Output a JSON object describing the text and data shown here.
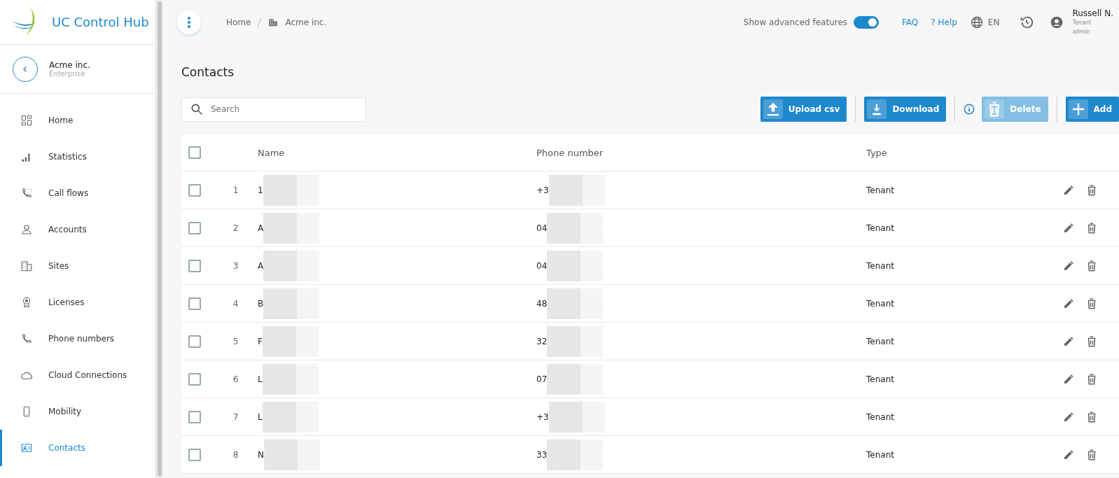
{
  "app": {
    "title": "UC Control Hub"
  },
  "tenant": {
    "name": "Acme inc.",
    "plan": "Enterprise"
  },
  "sidebar": {
    "items": [
      {
        "label": "Home",
        "selected": false
      },
      {
        "label": "Statistics",
        "selected": false
      },
      {
        "label": "Call flows",
        "selected": false
      },
      {
        "label": "Accounts",
        "selected": false
      },
      {
        "label": "Sites",
        "selected": false
      },
      {
        "label": "Licenses",
        "selected": false
      },
      {
        "label": "Phone numbers",
        "selected": false
      },
      {
        "label": "Cloud Connections",
        "selected": false
      },
      {
        "label": "Mobility",
        "selected": false
      },
      {
        "label": "Contacts",
        "selected": true
      }
    ]
  },
  "breadcrumb": [
    "Home",
    "Acme inc."
  ],
  "header": {
    "advanced_label": "Show advanced features",
    "advanced_on": true,
    "faq": "FAQ",
    "help_mark": "?",
    "help": "Help",
    "language": "EN",
    "user_name": "Russell N.",
    "user_role": "Tenant admin"
  },
  "page_title": "Contacts",
  "search": {
    "placeholder": "Search"
  },
  "actions": [
    {
      "kind": "upload",
      "label": "Upload csv",
      "disabled": false
    },
    {
      "kind": "download",
      "label": "Download",
      "disabled": false
    },
    {
      "kind": "delete",
      "label": "Delete",
      "disabled": true
    },
    {
      "kind": "add",
      "label": "Add",
      "disabled": false
    }
  ],
  "table": {
    "all_checked": false,
    "columns": [
      "Name",
      "Phone number",
      "Type"
    ],
    "rows": [
      {
        "index": "1",
        "name": "1",
        "phone": "+3",
        "type": "Tenant",
        "checked": false
      },
      {
        "index": "2",
        "name": "A",
        "phone": "04",
        "type": "Tenant",
        "checked": false
      },
      {
        "index": "3",
        "name": "A",
        "phone": "04",
        "type": "Tenant",
        "checked": false
      },
      {
        "index": "4",
        "name": "B",
        "phone": "48",
        "type": "Tenant",
        "checked": false
      },
      {
        "index": "5",
        "name": "F",
        "phone": "32",
        "type": "Tenant",
        "checked": false
      },
      {
        "index": "6",
        "name": "L",
        "phone": "07",
        "type": "Tenant",
        "checked": false
      },
      {
        "index": "7",
        "name": "L",
        "phone": "+3",
        "type": "Tenant",
        "checked": false
      },
      {
        "index": "8",
        "name": "N",
        "phone": "33",
        "type": "Tenant",
        "checked": false
      }
    ]
  }
}
